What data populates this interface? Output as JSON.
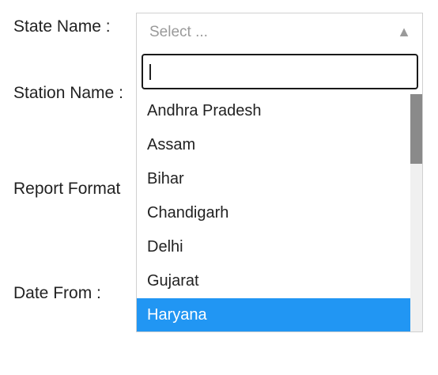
{
  "form": {
    "labels": {
      "state": "State Name :",
      "station": "Station Name :",
      "report": "Report Format",
      "date_from": "Date From :"
    }
  },
  "state_select": {
    "placeholder": "Select ...",
    "arrow_icon": "triangle-up-icon",
    "search_value": "",
    "options": [
      "Andhra Pradesh",
      "Assam",
      "Bihar",
      "Chandigarh",
      "Delhi",
      "Gujarat",
      "Haryana"
    ],
    "highlighted": "Haryana"
  },
  "colors": {
    "highlight": "#2196f3",
    "scroll_thumb": "#8a8a8a",
    "scroll_track": "#f0f0f0"
  }
}
